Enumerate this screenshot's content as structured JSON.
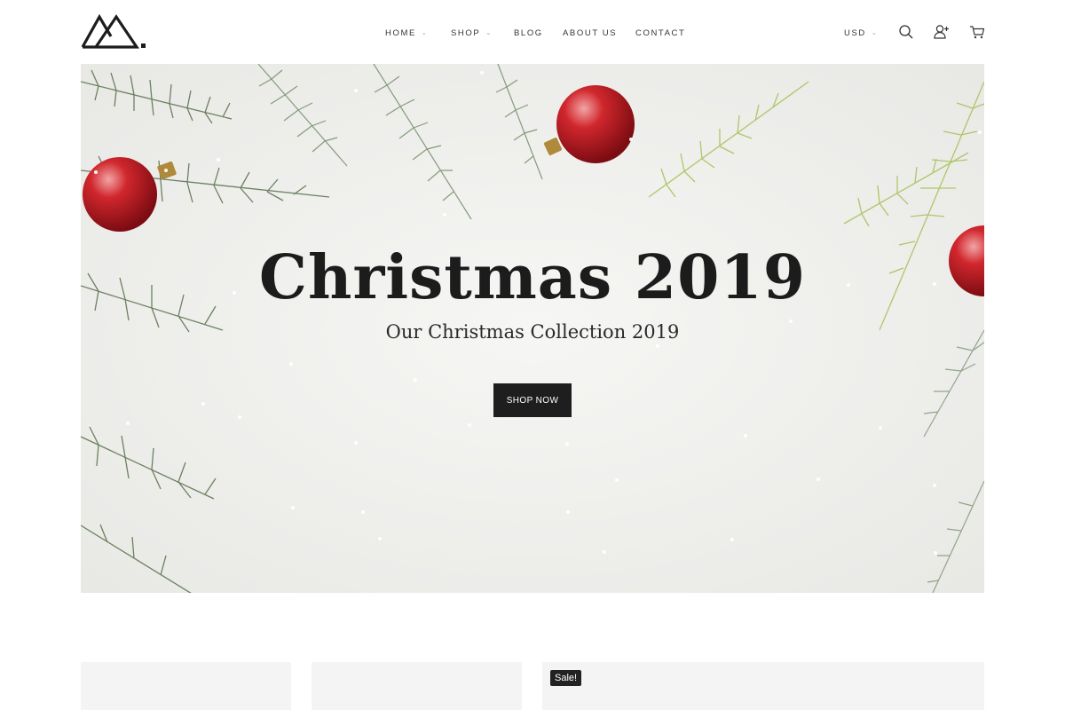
{
  "header": {
    "logo_icon": "mountain-logo-icon",
    "nav": [
      {
        "label": "HOME",
        "has_dropdown": true
      },
      {
        "label": "SHOP",
        "has_dropdown": true
      },
      {
        "label": "BLOG",
        "has_dropdown": false
      },
      {
        "label": "ABOUT US",
        "has_dropdown": false
      },
      {
        "label": "CONTACT",
        "has_dropdown": false
      }
    ],
    "caret_glyph": "⌄",
    "currency": "USD",
    "icons": [
      "search-icon",
      "add-user-icon",
      "cart-icon"
    ]
  },
  "hero": {
    "title": "Christmas 2019",
    "subtitle": "Our Christmas Collection 2019",
    "button_label": "SHOP NOW"
  },
  "products": {
    "sale_badge": "Sale!"
  },
  "colors": {
    "button_bg": "#1e1e1e",
    "ornament_red": "#c21e24",
    "pine_green": "#5f7a52",
    "light_pine": "#b9cf6a"
  }
}
